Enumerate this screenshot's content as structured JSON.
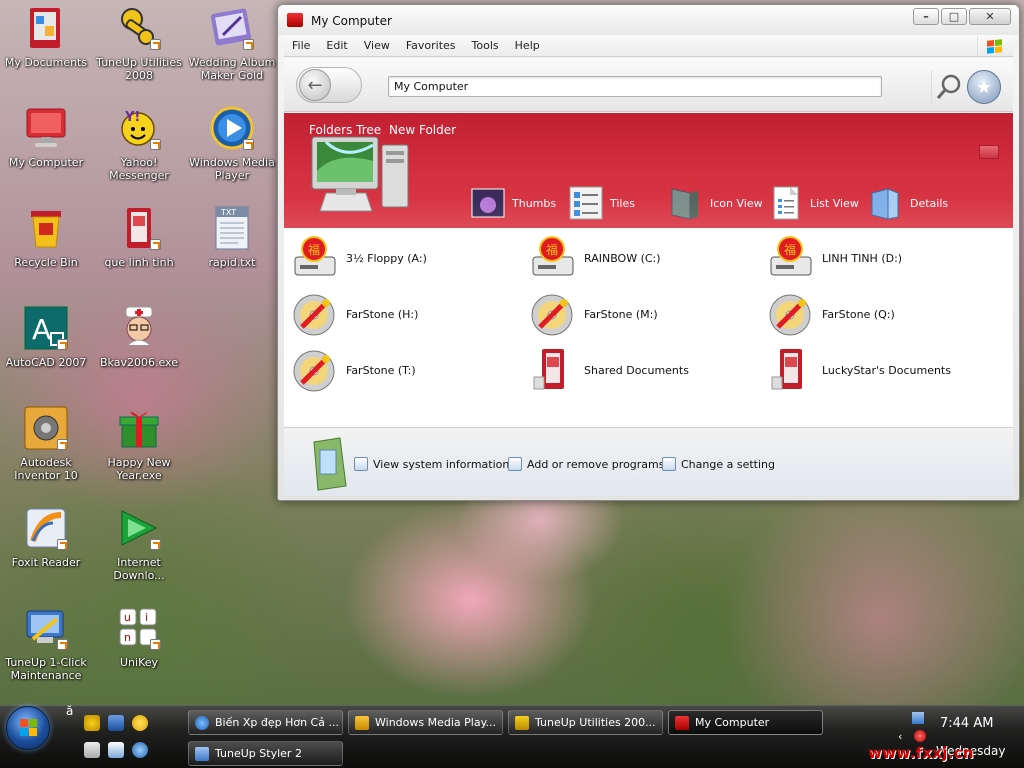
{
  "desktop": {
    "icons": [
      {
        "label": "My Documents"
      },
      {
        "label": "TuneUp Utilities 2008"
      },
      {
        "label": "Wedding Album Maker Gold"
      },
      {
        "label": "My Computer"
      },
      {
        "label": "Yahoo! Messenger"
      },
      {
        "label": "Windows Media Player"
      },
      {
        "label": "Recycle Bin"
      },
      {
        "label": "que linh tinh"
      },
      {
        "label": "rapid.txt"
      },
      {
        "label": "AutoCAD 2007"
      },
      {
        "label": "Bkav2006.exe"
      },
      {
        "label": "Autodesk Inventor 10"
      },
      {
        "label": "Happy New Year.exe"
      },
      {
        "label": "Foxit Reader"
      },
      {
        "label": "Internet Downlo..."
      },
      {
        "label": "TuneUp 1-Click Maintenance"
      },
      {
        "label": "UniKey"
      }
    ]
  },
  "window": {
    "title": "My Computer",
    "menu": [
      "File",
      "Edit",
      "View",
      "Favorites",
      "Tools",
      "Help"
    ],
    "address": "My Computer",
    "banner_links": [
      "Folders Tree",
      "New Folder"
    ],
    "views": [
      "Thumbs",
      "Tiles",
      "Icon View",
      "List View",
      "Details"
    ],
    "drives": [
      "3½ Floppy (A:)",
      "RAINBOW (C:)",
      "LINH TINH (D:)",
      "FarStone (H:)",
      "FarStone (M:)",
      "FarStone (Q:)",
      "FarStone (T:)",
      "Shared Documents",
      "LuckyStar's Documents"
    ],
    "tasks": [
      "View system information",
      "Add or remove programs",
      "Change a setting"
    ]
  },
  "taskbar": {
    "buttons": [
      "Biến Xp đẹp Hơn Cả ...",
      "Windows Media Play...",
      "TuneUp Utilities 200...",
      "My Computer",
      "TuneUp Styler 2"
    ],
    "time": "7:44 AM",
    "day": "Wednesday",
    "lang_indicator": "ă"
  },
  "watermark": "www.fxxj.cn"
}
